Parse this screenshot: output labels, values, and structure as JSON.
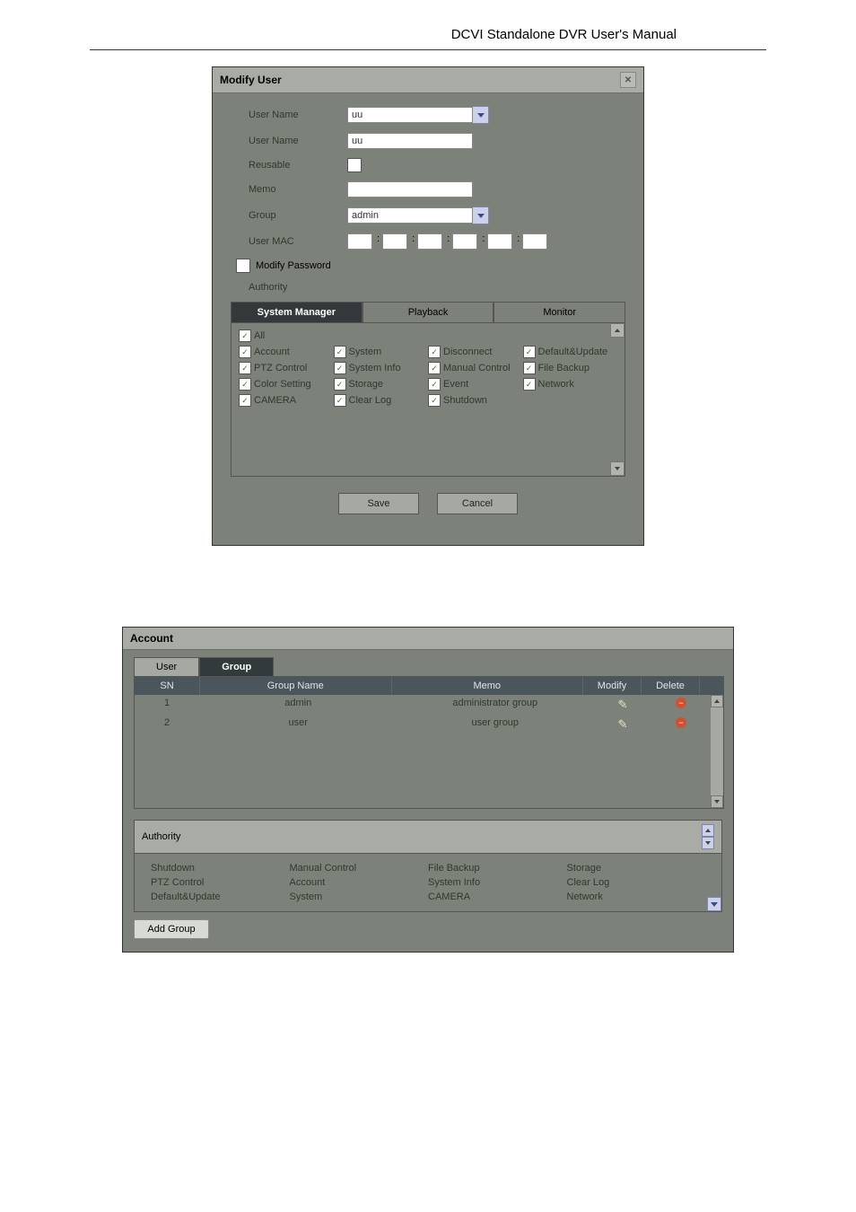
{
  "page_title": "DCVI Standalone DVR User's Manual",
  "modify_user": {
    "title": "Modify User",
    "fields": {
      "user_name1_label": "User Name",
      "user_name1_value": "uu",
      "user_name2_label": "User Name",
      "user_name2_value": "uu",
      "reusable_label": "Reusable",
      "memo_label": "Memo",
      "memo_value": "",
      "group_label": "Group",
      "group_value": "admin",
      "user_mac_label": "User MAC",
      "modify_password_label": "Modify Password",
      "authority_label": "Authority"
    },
    "tabs": {
      "system_manager": "System Manager",
      "playback": "Playback",
      "monitor": "Monitor"
    },
    "permissions": {
      "all": "All",
      "account": "Account",
      "system": "System",
      "disconnect": "Disconnect",
      "default_update": "Default&Update",
      "ptz_control": "PTZ Control",
      "system_info": "System Info",
      "manual_control": "Manual Control",
      "file_backup": "File Backup",
      "color_setting": "Color Setting",
      "storage": "Storage",
      "event": "Event",
      "network": "Network",
      "camera": "CAMERA",
      "clear_log": "Clear Log",
      "shutdown": "Shutdown"
    },
    "buttons": {
      "save": "Save",
      "cancel": "Cancel"
    }
  },
  "account": {
    "title": "Account",
    "tabs": {
      "user": "User",
      "group": "Group"
    },
    "table": {
      "headers": {
        "sn": "SN",
        "group_name": "Group Name",
        "memo": "Memo",
        "modify": "Modify",
        "delete": "Delete"
      },
      "rows": [
        {
          "sn": "1",
          "name": "admin",
          "memo": "administrator group"
        },
        {
          "sn": "2",
          "name": "user",
          "memo": "user group"
        }
      ]
    },
    "authority_label": "Authority",
    "authority_items": {
      "col1": [
        "Shutdown",
        "PTZ Control",
        "Default&Update"
      ],
      "col2": [
        "Manual Control",
        "Account",
        "System"
      ],
      "col3": [
        "File Backup",
        "System Info",
        "CAMERA"
      ],
      "col4": [
        "Storage",
        "Clear Log",
        "Network"
      ]
    },
    "add_group_label": "Add Group"
  }
}
